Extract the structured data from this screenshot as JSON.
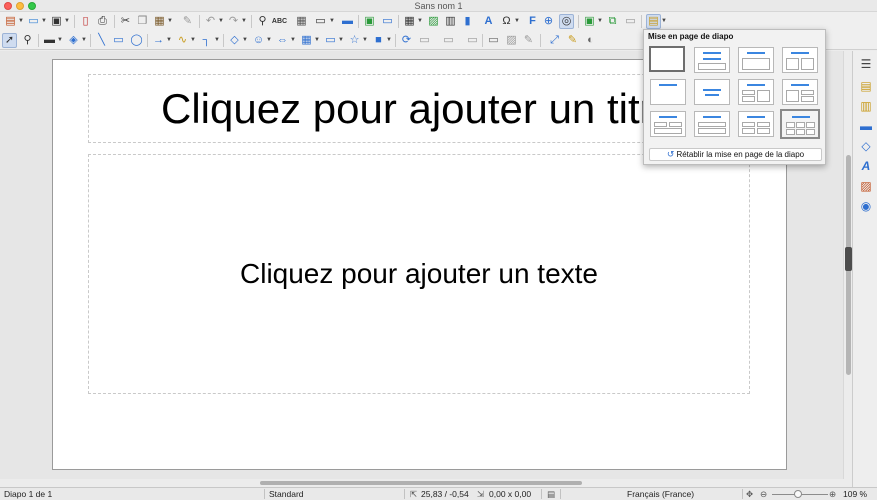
{
  "window": {
    "title": "Sans nom 1"
  },
  "toolbar_top": {
    "icons": [
      "new-document-icon",
      "open-folder-icon",
      "save-icon",
      "export-pdf-icon",
      "print-icon",
      "cut-icon",
      "copy-icon",
      "paste-icon",
      "clone-formatting-icon",
      "undo-icon",
      "redo-icon",
      "find-replace-icon",
      "spelling-icon",
      "grid-icon",
      "display-views-icon",
      "master-slide-icon",
      "new-slide-icon",
      "slide-show-icon",
      "table-icon",
      "image-icon",
      "chart-icon",
      "text-box-icon",
      "special-character-icon",
      "fontwork-icon",
      "hyperlink-icon",
      "shapes-mode-icon",
      "slide-layout-icon"
    ],
    "spelling_label": "ABC"
  },
  "toolbar_draw": {
    "icons": [
      "select-icon",
      "zoom-icon",
      "line-color-icon",
      "fill-color-icon",
      "line-icon",
      "rectangle-icon",
      "ellipse-icon",
      "arrow-line-icon",
      "curve-icon",
      "connector-icon",
      "basic-shapes-icon",
      "symbol-shapes-icon",
      "block-arrows-icon",
      "flowchart-icon",
      "callout-icon",
      "stars-icon",
      "3d-objects-icon",
      "rotate-icon",
      "align-icon",
      "arrange-icon",
      "distribute-icon",
      "shadow-icon",
      "crop-icon",
      "filter-icon",
      "points-icon",
      "glue-points-icon",
      "toggle-extrusion-icon"
    ]
  },
  "slide": {
    "title_placeholder": "Cliquez pour ajouter un titre",
    "body_placeholder": "Cliquez pour ajouter un texte"
  },
  "layout_popup": {
    "title": "Mise en page de diapo",
    "reset_label": "Rétablir la mise en page de la diapo",
    "layouts": [
      "blank",
      "title-content",
      "title-content-2col",
      "title-2content",
      "title-only",
      "centered-text",
      "title-2content-1",
      "title-1content-2",
      "title-2content-top",
      "title-content-bottom",
      "title-4content",
      "title-6content"
    ],
    "selected_index": 0,
    "hovered_index": 11
  },
  "sidebar": {
    "icons": [
      "properties-icon",
      "slide-transition-icon",
      "animation-icon",
      "master-slides-icon",
      "shapes-icon",
      "styles-icon",
      "gallery-icon",
      "navigator-icon"
    ]
  },
  "statusbar": {
    "slide_info": "Diapo 1 de 1",
    "master": "Standard",
    "position": "25,83 / -0,54",
    "size": "0,00 x 0,00",
    "language": "Français (France)",
    "zoom": "109 %"
  },
  "colors": {
    "accent": "#3b86e0",
    "selection": "#cfdcf0"
  }
}
